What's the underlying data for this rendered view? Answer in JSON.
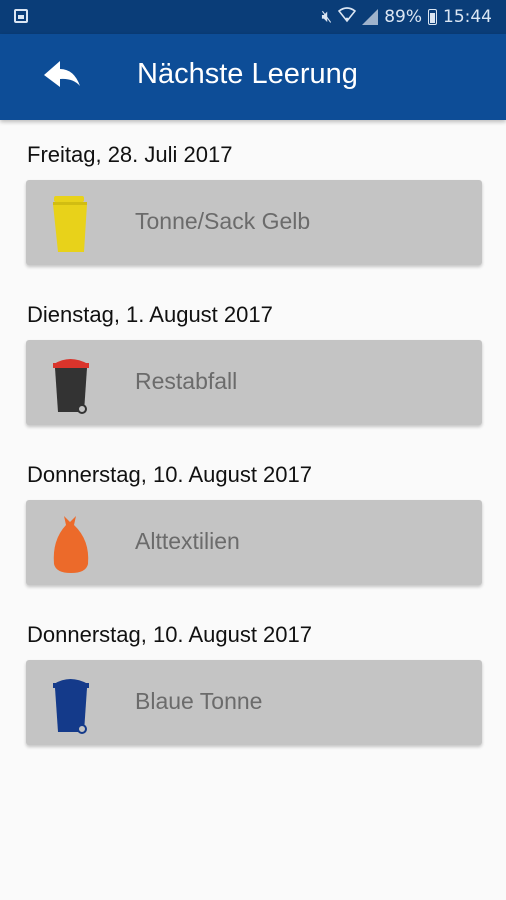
{
  "status_bar": {
    "battery": "89%",
    "time": "15:44",
    "icons": [
      "gallery-icon",
      "mute-icon",
      "wifi-icon",
      "signal-icon",
      "battery-icon"
    ]
  },
  "app_bar": {
    "title": "Nächste Leerung",
    "back_icon": "back-arrow-icon",
    "color": "#0d4d97"
  },
  "entries": [
    {
      "date": "Freitag, 28. Juli 2017",
      "label": "Tonne/Sack Gelb",
      "icon": "yellow-bin-icon",
      "color": "#e8d21a"
    },
    {
      "date": "Dienstag, 1. August 2017",
      "label": "Restabfall",
      "icon": "black-bin-icon",
      "color": "#333333"
    },
    {
      "date": "Donnerstag, 10. August 2017",
      "label": "Alttextilien",
      "icon": "orange-bag-icon",
      "color": "#ec6a2a"
    },
    {
      "date": "Donnerstag, 10. August 2017",
      "label": "Blaue Tonne",
      "icon": "blue-bin-icon",
      "color": "#143a8a"
    }
  ]
}
